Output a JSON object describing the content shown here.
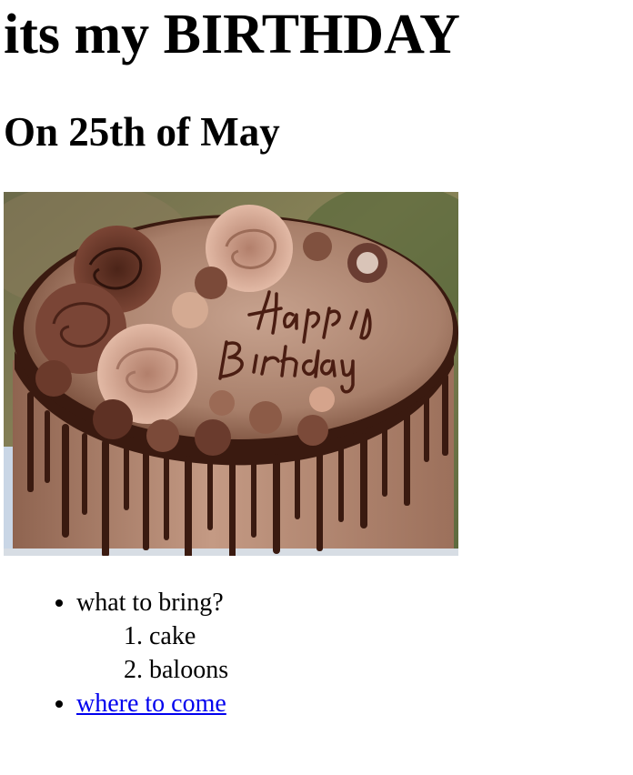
{
  "page": {
    "heading": "its my BIRTHDAY",
    "subheading": "On 25th of May"
  },
  "image": {
    "cake_text_line1": "Happy",
    "cake_text_line2": "Birthday"
  },
  "list": {
    "item1": "what to bring?",
    "subitems": [
      "cake",
      "baloons"
    ],
    "item2_link": "where to come"
  },
  "colors": {
    "link": "#0000ee",
    "text": "#000000",
    "background": "#ffffff"
  }
}
